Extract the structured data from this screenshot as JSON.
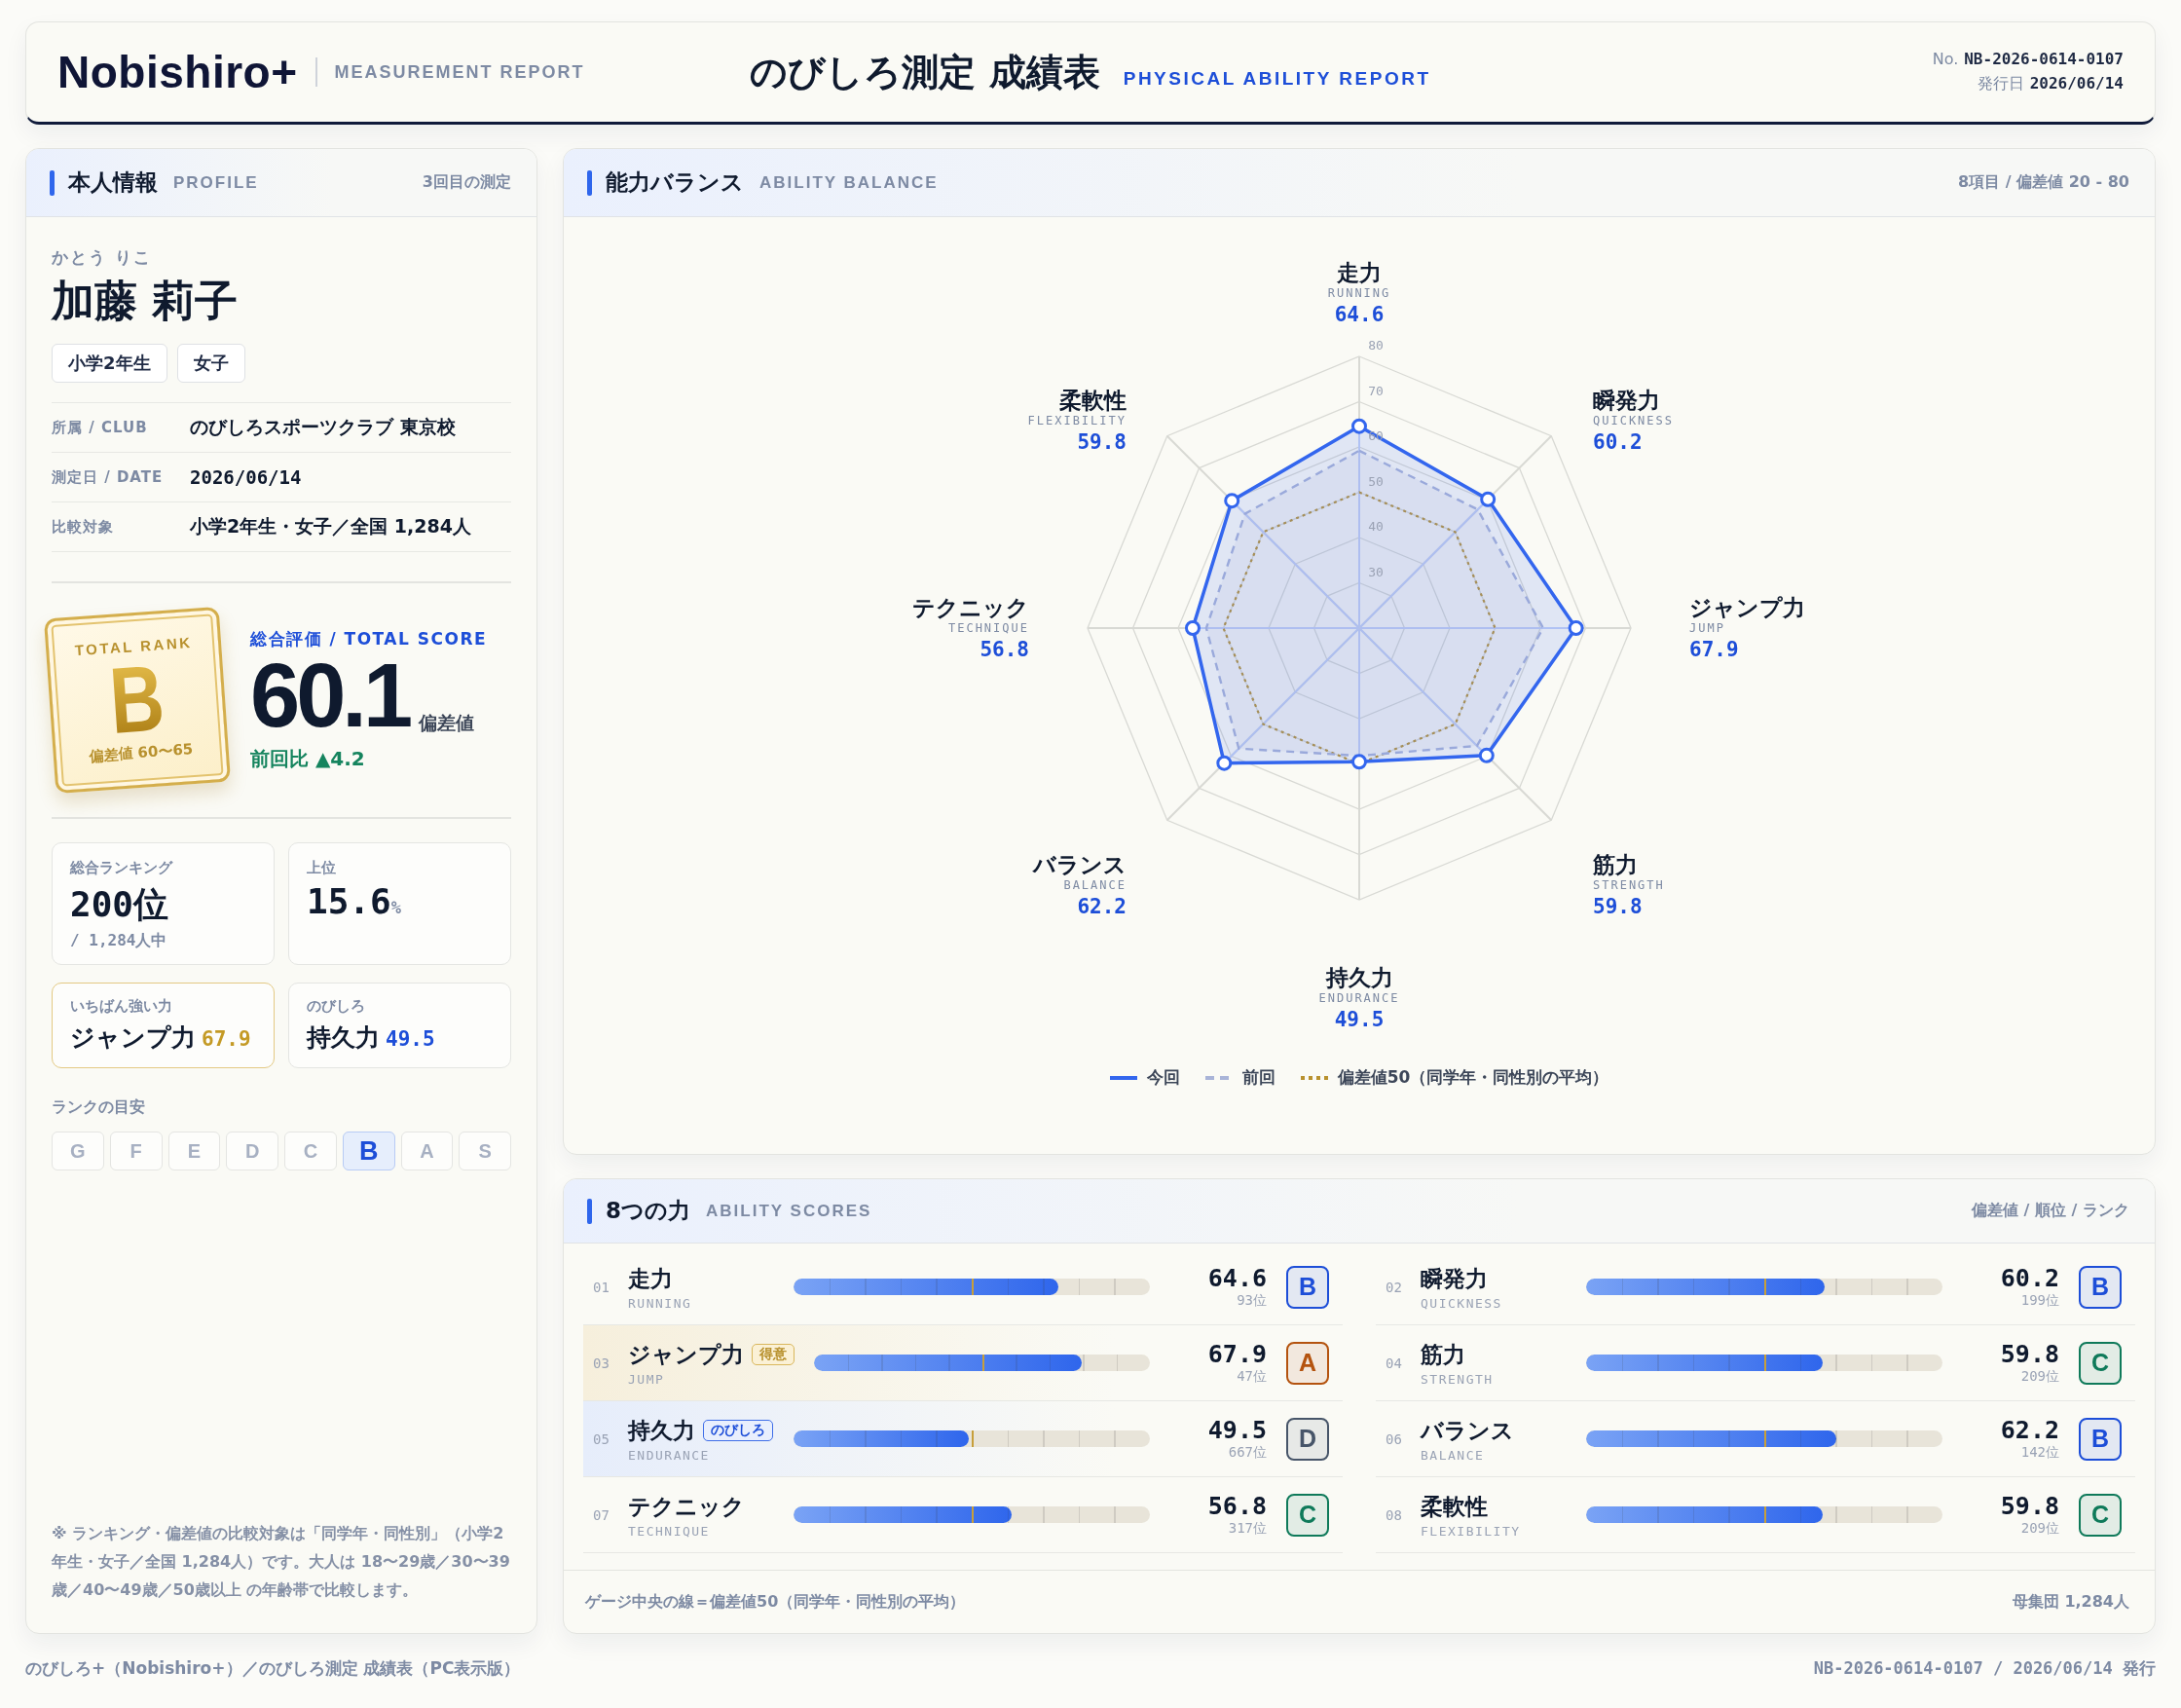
{
  "header": {
    "logo": "Nobishiro+",
    "logo_sub": "MEASUREMENT REPORT",
    "title": "のびしろ測定 成績表",
    "title_en": "PHYSICAL ABILITY REPORT",
    "number_label": "No.",
    "number": "NB-2026-0614-0107",
    "issued_label": "発行日",
    "issued": "2026/06/14"
  },
  "profile": {
    "title": "本人情報",
    "title_en": "PROFILE",
    "note": "3回目の測定",
    "kana": "かとう りこ",
    "name": "加藤 莉子",
    "tags": [
      "小学2年生",
      "女子"
    ],
    "details": [
      {
        "label": "所属 / CLUB",
        "value": "のびしろスポーツクラブ 東京校"
      },
      {
        "label": "測定日 / DATE",
        "value": "2026/06/14"
      },
      {
        "label": "比較対象",
        "value": "小学2年生・女子／全国 1,284人"
      }
    ],
    "rank_card": {
      "label": "TOTAL RANK",
      "grade": "B",
      "range": "偏差値 60〜65"
    },
    "total": {
      "label": "総合評価 / TOTAL SCORE",
      "score": "60.1",
      "unit": "偏差値",
      "delta": "前回比 ▲4.2"
    },
    "stats": [
      {
        "label": "総合ランキング",
        "value": "200位",
        "sub": "/ 1,284人中"
      },
      {
        "label": "上位",
        "value": "15.6",
        "unit": "%"
      }
    ],
    "highlights": [
      {
        "kind": "strong",
        "label": "いちばん強い力",
        "name": "ジャンプ力",
        "value": "67.9"
      },
      {
        "kind": "growth",
        "label": "のびしろ",
        "name": "持久力",
        "value": "49.5"
      }
    ],
    "rank_scale_label": "ランクの目安",
    "rank_scale": [
      {
        "grade": "G",
        "selected": false
      },
      {
        "grade": "F",
        "selected": false
      },
      {
        "grade": "E",
        "selected": false
      },
      {
        "grade": "D",
        "selected": false
      },
      {
        "grade": "C",
        "selected": false
      },
      {
        "grade": "B",
        "selected": true
      },
      {
        "grade": "A",
        "selected": false
      },
      {
        "grade": "S",
        "selected": false
      }
    ],
    "footnote": "※ ランキング・偏差値の比較対象は「同学年・同性別」（小学2年生・女子／全国 1,284人）です。大人は 18〜29歳／30〜39歳／40〜49歳／50歳以上 の年齢帯で比較します。"
  },
  "balance": {
    "title": "能力バランス",
    "title_en": "ABILITY BALANCE",
    "note": "8項目 / 偏差値 20 - 80",
    "axes": [
      {
        "name": "走力",
        "en": "RUNNING",
        "value": "64.6",
        "level": 0.743
      },
      {
        "name": "瞬発力",
        "en": "QUICKNESS",
        "value": "60.2",
        "level": 0.67
      },
      {
        "name": "ジャンプ力",
        "en": "JUMP",
        "value": "67.9",
        "level": 0.798
      },
      {
        "name": "筋力",
        "en": "STRENGTH",
        "value": "59.8",
        "level": 0.663
      },
      {
        "name": "持久力",
        "en": "ENDURANCE",
        "value": "49.5",
        "level": 0.492
      },
      {
        "name": "バランス",
        "en": "BALANCE",
        "value": "62.2",
        "level": 0.703
      },
      {
        "name": "テクニック",
        "en": "TECHNIQUE",
        "value": "56.8",
        "level": 0.613
      },
      {
        "name": "柔軟性",
        "en": "FLEXIBILITY",
        "value": "59.8",
        "level": 0.663
      }
    ],
    "ticks": [
      "80",
      "70",
      "60",
      "50",
      "40",
      "30"
    ],
    "legend": [
      {
        "kind": "current",
        "label": "今回"
      },
      {
        "kind": "previous",
        "label": "前回"
      },
      {
        "kind": "average",
        "label": "偏差値50（同学年・同性別の平均）"
      }
    ]
  },
  "scores": {
    "title": "8つの力",
    "title_en": "ABILITY SCORES",
    "note": "偏差値 / 順位 / ランク",
    "items": [
      {
        "number": "01",
        "name": "走力",
        "en": "RUNNING",
        "level": 0.743,
        "value": "64.6",
        "rank": "93位",
        "grade": "B",
        "color": "#1d4ed8"
      },
      {
        "number": "02",
        "name": "瞬発力",
        "en": "QUICKNESS",
        "level": 0.67,
        "value": "60.2",
        "rank": "199位",
        "grade": "B",
        "color": "#1d4ed8"
      },
      {
        "number": "03",
        "name": "ジャンプ力",
        "en": "JUMP",
        "tag": {
          "kind": "strong",
          "text": "得意"
        },
        "level": 0.798,
        "value": "67.9",
        "rank": "47位",
        "grade": "A",
        "color": "#b4530f"
      },
      {
        "number": "04",
        "name": "筋力",
        "en": "STRENGTH",
        "level": 0.663,
        "value": "59.8",
        "rank": "209位",
        "grade": "C",
        "color": "#0f7a5a"
      },
      {
        "number": "05",
        "name": "持久力",
        "en": "ENDURANCE",
        "tag": {
          "kind": "growth",
          "text": "のびしろ"
        },
        "level": 0.492,
        "value": "49.5",
        "rank": "667位",
        "grade": "D",
        "color": "#475569"
      },
      {
        "number": "06",
        "name": "バランス",
        "en": "BALANCE",
        "level": 0.703,
        "value": "62.2",
        "rank": "142位",
        "grade": "B",
        "color": "#1d4ed8"
      },
      {
        "number": "07",
        "name": "テクニック",
        "en": "TECHNIQUE",
        "level": 0.613,
        "value": "56.8",
        "rank": "317位",
        "grade": "C",
        "color": "#0f7a5a"
      },
      {
        "number": "08",
        "name": "柔軟性",
        "en": "FLEXIBILITY",
        "level": 0.663,
        "value": "59.8",
        "rank": "209位",
        "grade": "C",
        "color": "#0f7a5a"
      }
    ],
    "footer_note": "ゲージ中央の線＝偏差値50（同学年・同性別の平均）",
    "population": "母集団 1,284人"
  },
  "footer": {
    "left": "のびしろ+（Nobishiro+）／のびしろ測定 成績表（PC表示版）",
    "right": "NB-2026-0614-0107 / 2026/06/14 発行"
  }
}
